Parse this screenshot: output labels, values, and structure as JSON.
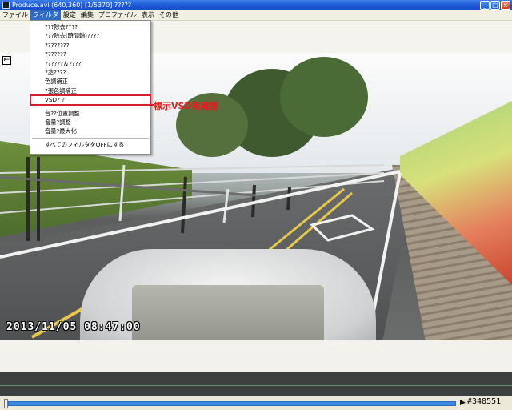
{
  "window": {
    "title": "Produce.avi (640,360)  [1/5370]  ?????",
    "minimize": "_",
    "maximize": "□",
    "close": "×"
  },
  "menubar": {
    "items": [
      "ファイル",
      "フィルタ",
      "設定",
      "編集",
      "プロファイル",
      "表示",
      "その他"
    ]
  },
  "filter_menu": {
    "items": [
      "???除去????",
      "???除去(時間軸)????",
      "????????",
      "???????",
      "??????＆????",
      "?塗????",
      "色調補正",
      "?張色調補正",
      "VSD?          ?",
      "音??位置調整",
      "音量?調整",
      "音量?最大化",
      "すべてのフィルタをOFFにする"
    ]
  },
  "annotation": {
    "text": "標示VSD有維護"
  },
  "video": {
    "timestamp": "2013/11/05 08:47:00"
  },
  "seekbar": {
    "frame": "#348551",
    "play_icon": "▶"
  },
  "side": {
    "collapse_icon": "⇤"
  },
  "colors": {
    "highlight": "#d21f2e",
    "titlebar": "#1d5ad8",
    "seek": "#3b89e3"
  }
}
